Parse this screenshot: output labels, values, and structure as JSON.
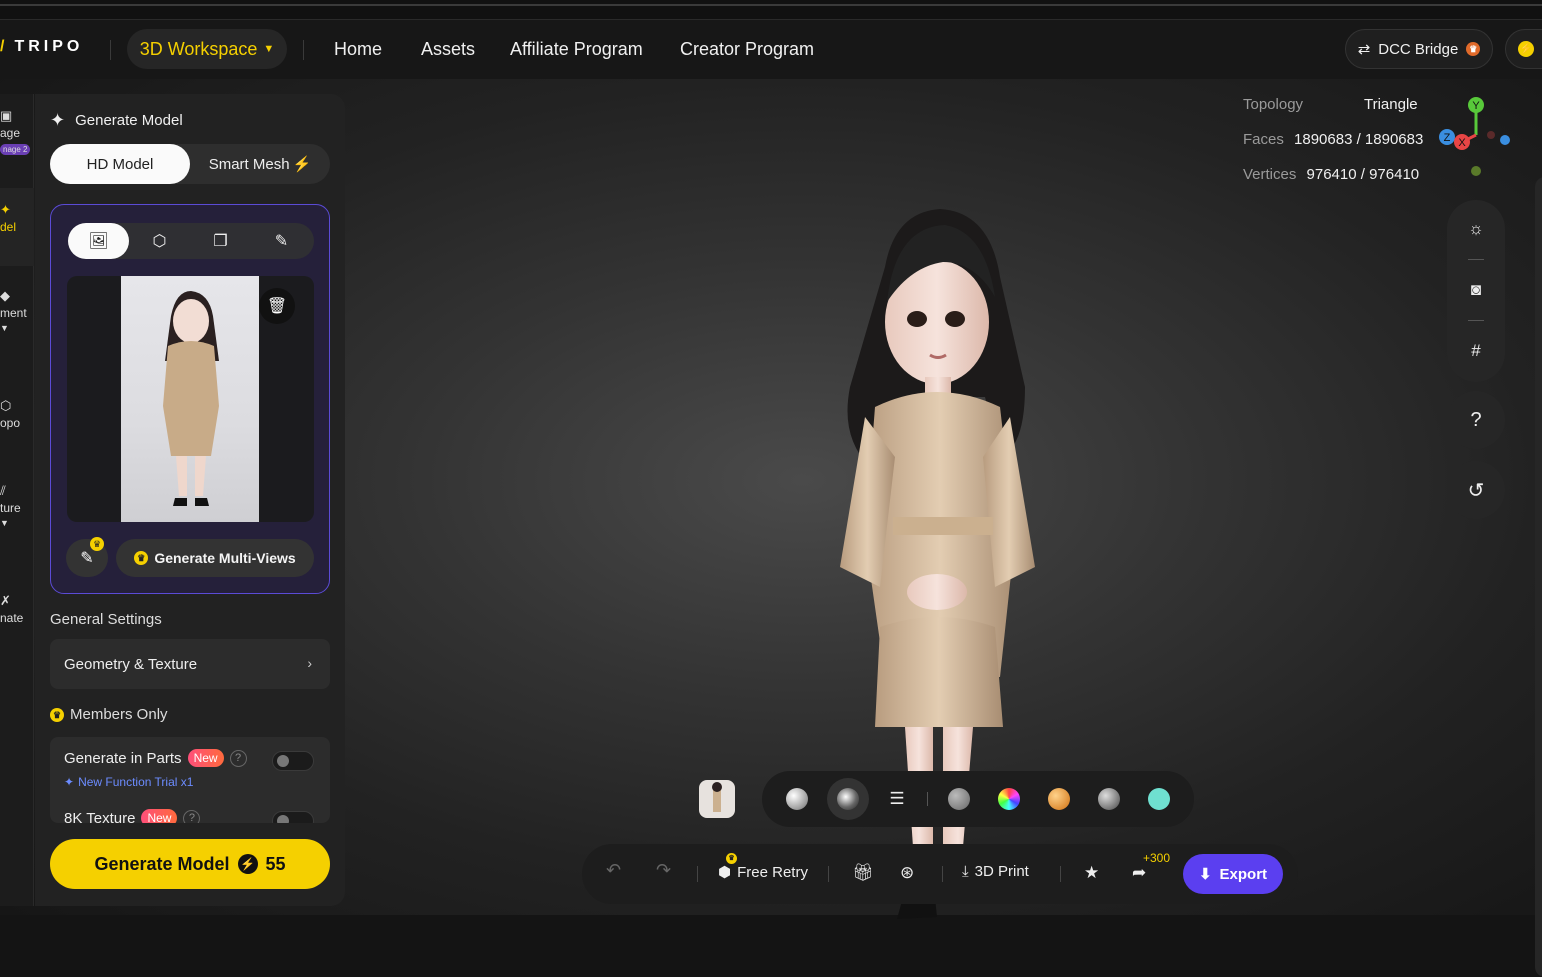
{
  "header": {
    "logo": "TRIPO",
    "workspace": "3D Workspace",
    "nav": [
      "Home",
      "Assets",
      "Affiliate Program",
      "Creator Program"
    ],
    "dcc_bridge": "DCC Bridge"
  },
  "left_rail": {
    "items": [
      {
        "label": "age",
        "badge": "nage 2"
      },
      {
        "label": "del"
      },
      {
        "label": "ment"
      },
      {
        "label": "opo"
      },
      {
        "label": "ture"
      },
      {
        "label": "nate"
      }
    ]
  },
  "panel": {
    "title": "Generate Model",
    "mode_hd": "HD Model",
    "mode_smart": "Smart Mesh",
    "multiview_button": "Generate Multi-Views",
    "general_settings": "General Settings",
    "geometry_texture": "Geometry & Texture",
    "members_only": "Members Only",
    "generate_in_parts": "Generate in Parts",
    "new_badge": "New",
    "help_mark": "?",
    "trial": "New Function Trial x1",
    "texture_8k": "8K Texture",
    "generate_button": "Generate Model",
    "generate_cost": "55"
  },
  "stats": {
    "topology_label": "Topology",
    "topology_value": "Triangle",
    "faces_label": "Faces",
    "faces_value": "1890683 / 1890683",
    "vertices_label": "Vertices",
    "vertices_value": "976410 / 976410"
  },
  "axis": {
    "y": "Y",
    "z": "Z",
    "x": "X"
  },
  "help_button": "?",
  "action_bar": {
    "free_retry": "Free Retry",
    "print": "3D Print",
    "bonus": "+300",
    "export": "Export"
  },
  "colors": {
    "brand_yellow": "#f5d000",
    "export_purple": "#5b3ff0",
    "card_border": "#5b4bd6"
  }
}
